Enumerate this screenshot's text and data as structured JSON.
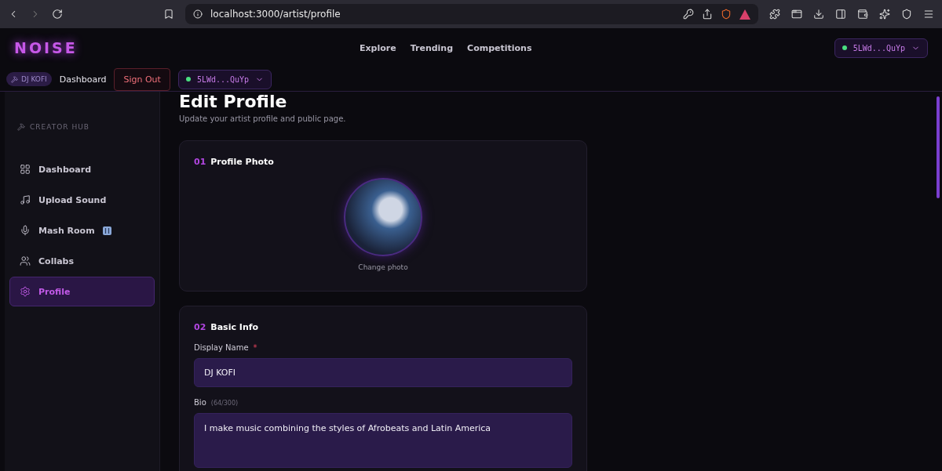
{
  "browser": {
    "url": "localhost:3000/artist/profile"
  },
  "header": {
    "logo": "NOISE",
    "nav": [
      {
        "label": "Explore"
      },
      {
        "label": "Trending"
      },
      {
        "label": "Competitions"
      }
    ],
    "wallet": {
      "address": "5LWd...QuYp",
      "connected": true
    }
  },
  "subbar": {
    "user_badge": "DJ KOFI",
    "dashboard_link": "Dashboard",
    "sign_out": "Sign Out",
    "wallet": {
      "address": "5LWd...QuYp",
      "connected": true
    }
  },
  "sidebar": {
    "heading": "CREATOR HUB",
    "items": [
      {
        "label": "Dashboard",
        "kind": "grid",
        "selected": false
      },
      {
        "label": "Upload Sound",
        "kind": "note",
        "selected": false
      },
      {
        "label": "Mash Room",
        "kind": "mic",
        "selected": false,
        "badge": true
      },
      {
        "label": "Collabs",
        "kind": "users",
        "selected": false
      },
      {
        "label": "Profile",
        "kind": "gear",
        "selected": true
      }
    ]
  },
  "page": {
    "title": "Edit Profile",
    "subtitle": "Update your artist profile and public page."
  },
  "sections": [
    {
      "number": "01",
      "title": "Profile Photo",
      "kind": "photo",
      "change_label": "Change photo"
    },
    {
      "number": "02",
      "title": "Basic Info",
      "kind": "form",
      "fields": [
        {
          "label": "Display Name",
          "required_mark": "*",
          "value": "DJ KOFI",
          "kind": "input"
        },
        {
          "label": "Bio",
          "hint": "(64/300)",
          "value": "I make music combining the styles of Afrobeats and Latin America",
          "kind": "textarea"
        }
      ]
    }
  ]
}
